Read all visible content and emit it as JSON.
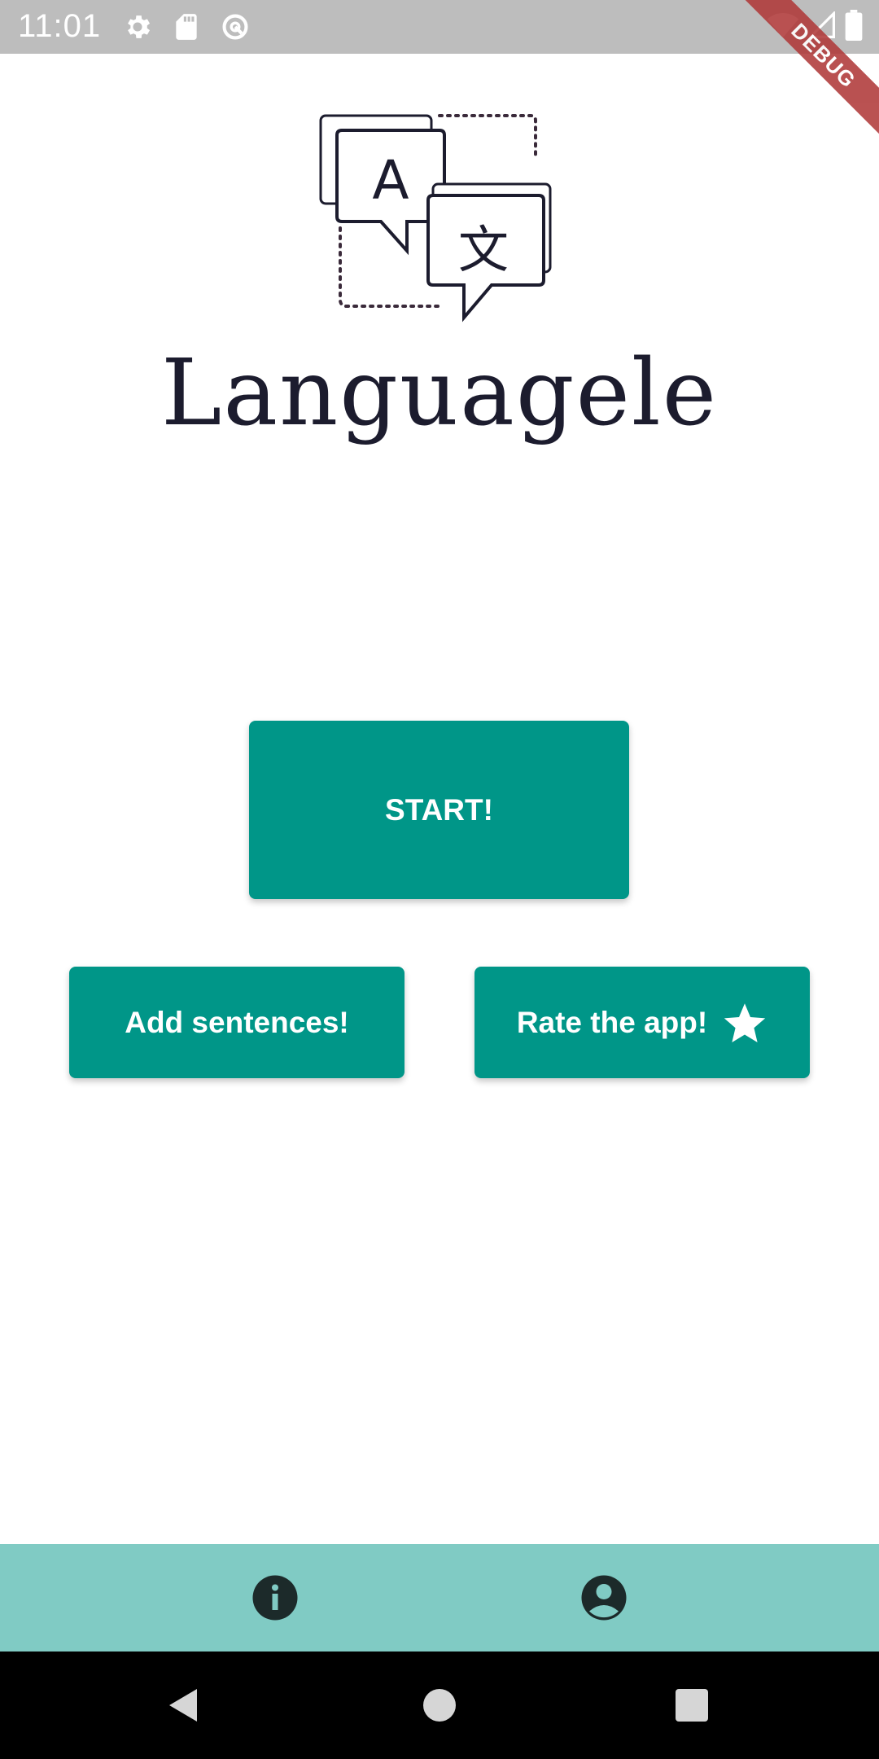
{
  "status_bar": {
    "time": "11:01",
    "icons": [
      "gear-icon",
      "sd-card-icon",
      "data-saver-icon",
      "wifi-icon",
      "signal-icon",
      "battery-icon"
    ]
  },
  "debug_banner": {
    "label": "DEBUG",
    "color": "#b03a3a"
  },
  "logo": {
    "wordmark": "Languagele",
    "glyph_latin": "A",
    "glyph_cjk": "文"
  },
  "buttons": {
    "start_label": "START!",
    "add_label": "Add sentences!",
    "rate_label": "Rate the app!",
    "rate_icon": "star-icon"
  },
  "bottom_nav": {
    "items": [
      {
        "icon": "info-icon"
      },
      {
        "icon": "account-icon"
      }
    ]
  },
  "system_nav": {
    "buttons": [
      "back-icon",
      "home-icon",
      "recents-icon"
    ]
  },
  "colors": {
    "primary": "#009688",
    "bottom_nav": "#80cbc4",
    "status_bar": "#bdbdbd",
    "system_nav": "#000000",
    "button_text": "#ffffff"
  }
}
